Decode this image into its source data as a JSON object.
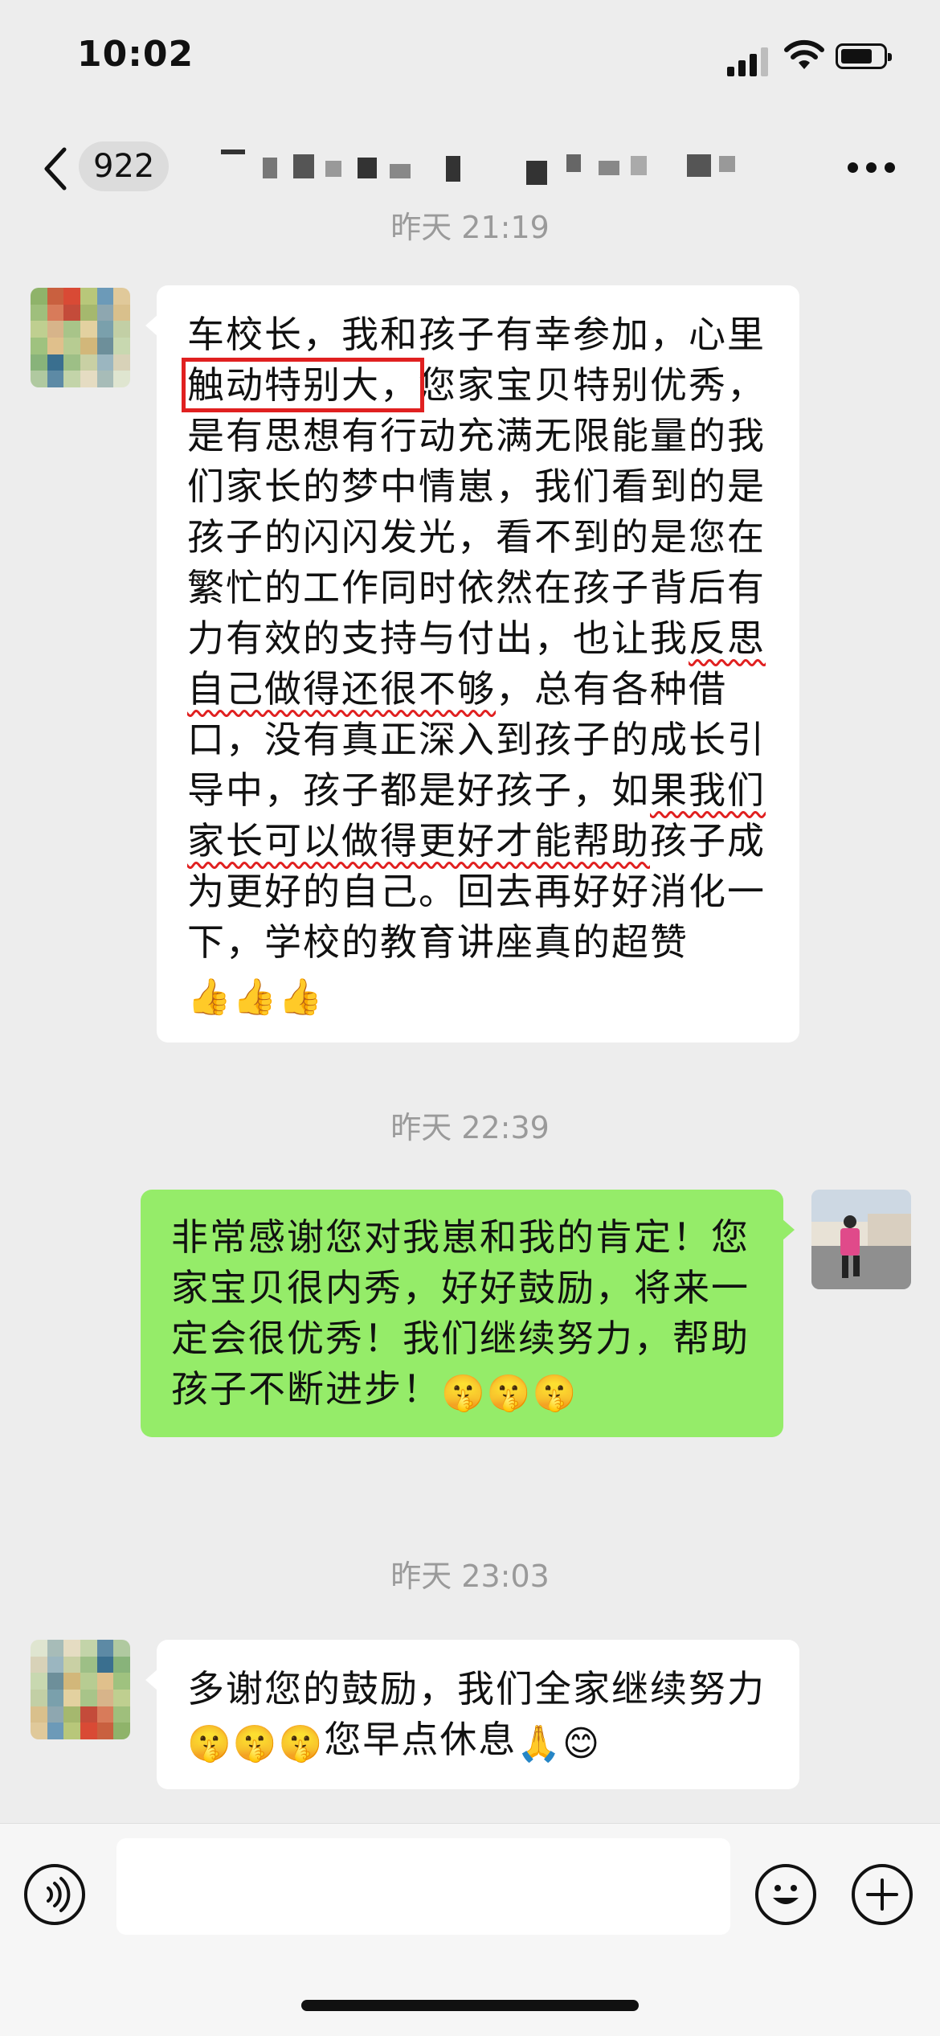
{
  "status_bar": {
    "time": "10:02"
  },
  "nav": {
    "unread_count": "922"
  },
  "timestamps": [
    "昨天 21:19",
    "昨天 22:39",
    "昨天 23:03"
  ],
  "messages": [
    {
      "side": "left",
      "segments": [
        {
          "text": "车校长，我和孩子有幸参加，心里",
          "style": "normal"
        },
        {
          "text": "触动特别大，",
          "style": "box"
        },
        {
          "text": "您家宝贝特别优秀，是有思想有行动充满无限能量的我们家长的梦中情崽，我们看到的是孩子的闪闪发光，看不到的是您在繁忙的工作同时依然在孩子背后有力有效的支持与付出，也让我",
          "style": "normal"
        },
        {
          "text": "反思自己做得还很不够",
          "style": "wavy"
        },
        {
          "text": "，总有各种借口，没有真正深入到孩子的成长引导中，孩子都是好孩子，如",
          "style": "normal"
        },
        {
          "text": "果我们家长可以做得更好才能帮助",
          "style": "wavy"
        },
        {
          "text": "孩子成为更好的自己。回去再好好消化一下，学校的教育讲座真的超赞",
          "style": "normal"
        },
        {
          "text": "👍👍👍",
          "style": "emoji"
        }
      ]
    },
    {
      "side": "right",
      "segments": [
        {
          "text": "非常感谢您对我崽和我的肯定！您家宝贝很内秀，好好鼓励，将来一定会很优秀！我们继续努力，帮助孩子不断进步！",
          "style": "normal"
        },
        {
          "text": "🤫🤫🤫",
          "style": "emoji"
        }
      ]
    },
    {
      "side": "left",
      "segments": [
        {
          "text": "多谢您的鼓励，我们全家继续努力",
          "style": "normal"
        },
        {
          "text": "🤫🤫🤫",
          "style": "emoji"
        },
        {
          "text": "您早点休息",
          "style": "normal"
        },
        {
          "text": "🙏😊",
          "style": "emoji"
        }
      ]
    }
  ],
  "icons": {
    "back": "chevron-left-icon",
    "more": "more-icon",
    "voice": "voice-icon",
    "emoji": "emoji-icon",
    "plus": "plus-icon"
  },
  "colors": {
    "background": "#ededed",
    "left_bubble": "#ffffff",
    "right_bubble": "#95ec69",
    "highlight": "#e02020"
  }
}
